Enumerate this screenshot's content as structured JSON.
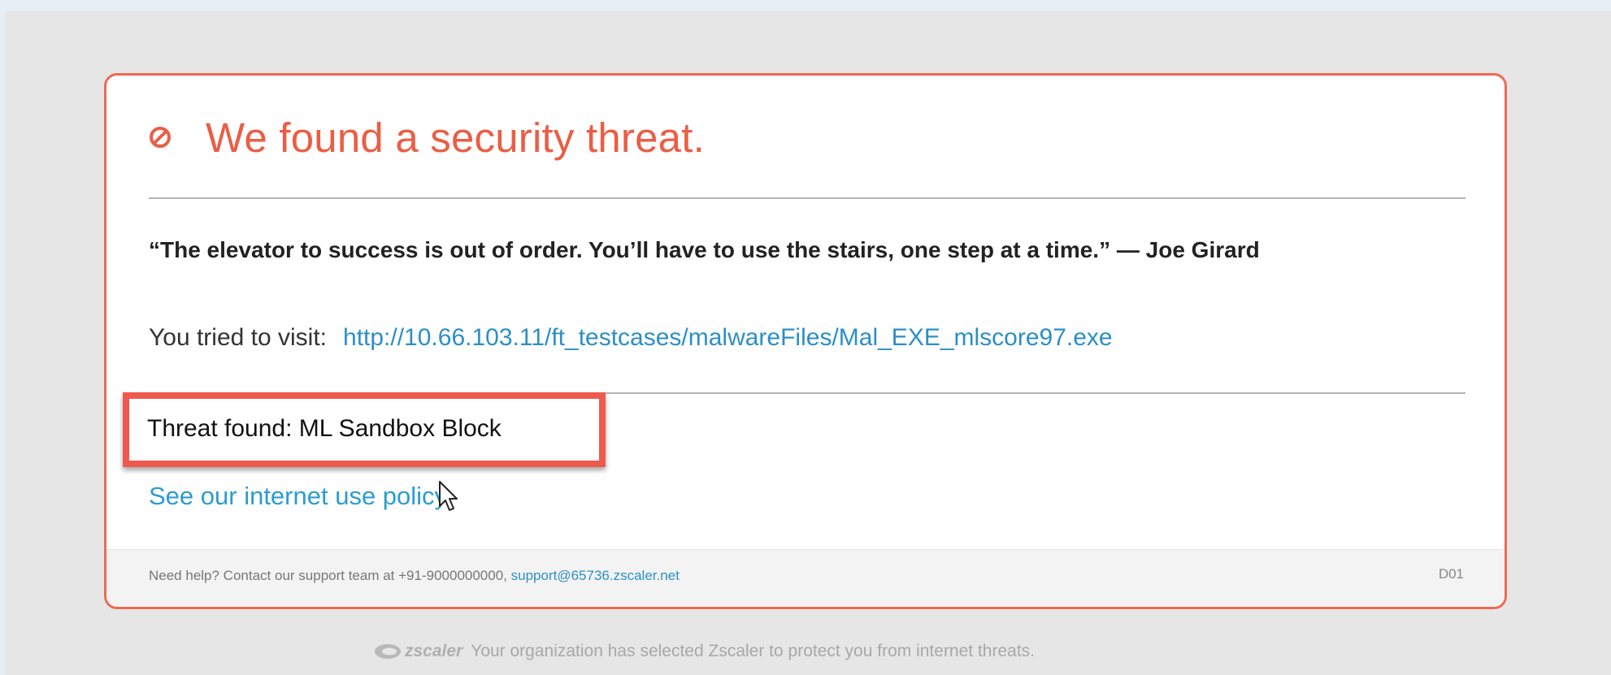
{
  "page": {
    "title": "We found a security threat.",
    "quote": "“The elevator to success is out of order. You’ll have to use the stairs, one step at a time.” — Joe Girard",
    "visit_label": "You tried to visit:",
    "visit_url": "http://10.66.103.11/ft_testcases/malwareFiles/Mal_EXE_mlscore97.exe",
    "threat": "Threat found: ML Sandbox Block",
    "policy_link": "See our internet use policy.",
    "help_text": "Need help? Contact our support team at +91-9000000000,",
    "help_email": "support@65736.zscaler.net",
    "code": "D01"
  },
  "branding": {
    "logo_text": "zscaler",
    "tagline": "Your organization has selected Zscaler to protect you from internet threats."
  },
  "icons": {
    "block": "block-icon",
    "cursor": "cursor-icon",
    "logo": "zscaler-logo-icon"
  },
  "colors": {
    "accent": "#ea5e45",
    "border": "#ee6a52",
    "link": "#2c8fc6",
    "highlight": "#ee5a4d"
  }
}
